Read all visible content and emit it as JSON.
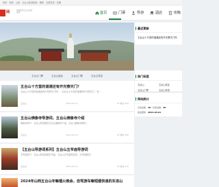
{
  "topbar": {
    "text": "首页 · 旅游 · 山西 · 五台山旅游指南 · 佛教 · 名胜导游 · 攻略"
  },
  "site": {
    "logo_text": "网",
    "name": "网",
    "tagline": "佛教胜地五台山旅游攻略"
  },
  "nav": [
    {
      "label": "首页",
      "icon": "home-icon",
      "active": true
    },
    {
      "label": "门票",
      "icon": "ticket-icon",
      "active": false
    },
    {
      "label": "导游",
      "icon": "guide-icon",
      "active": false
    },
    {
      "label": "酒店",
      "icon": "hotel-icon",
      "active": false
    },
    {
      "label": "攻略",
      "icon": "guide-book-icon",
      "active": false
    }
  ],
  "hero": {
    "tabs": [
      "五台山门票",
      "五台山酒店",
      "五台山门票",
      "五台山导游"
    ]
  },
  "articles": [
    {
      "title": "五台山十方堂的道通还有开光寮天门？",
      "desc": "五台山十方堂的道通还有开光寮天门吗？...五台山十方堂的道通有开光寮天门，但...",
      "category": "五台山",
      "date": "2024-05-12",
      "views": "阅读 255"
    },
    {
      "title": "五台山佛像寺导游词，五台山佛像寺介绍",
      "desc": "佛像寺简介：五台山导游提供五台山佛像寺介绍，五台山佛像寺概况...",
      "category": "五台山",
      "date": "2024-05-12",
      "views": "阅读 180"
    },
    {
      "title": "【五台山导游词系列】五台山五爷庙导游词",
      "desc": "五爷庙简介：五台山导游讲解五爷庙，五台山五爷庙导游词，五爷庙概况...",
      "category": "五台山",
      "date": "2024-05-12",
      "views": "阅读 215"
    },
    {
      "title": "2024年山西五台山年嘛烟火晚会，自驾游车嘛短烟快速的东进山",
      "desc": "",
      "category": "",
      "date": "",
      "views": ""
    }
  ],
  "sidebar": {
    "latest": {
      "title": "最近更新",
      "item": "五台山十方堂的道通还有开光寮天门吗"
    },
    "tags": {
      "title": "热门标签",
      "items": [
        "五台山",
        "五台山景区",
        "五台山门票",
        "五台山导游"
      ]
    },
    "stats": {
      "title": "网站统计",
      "rows": [
        {
          "label": "日志总数：",
          "value": "28",
          "label2": "标签总数：",
          "value2": "28"
        },
        {
          "label": "最后更新：",
          "value": "2024-05-01",
          "label2": "",
          "value2": ""
        }
      ]
    }
  }
}
